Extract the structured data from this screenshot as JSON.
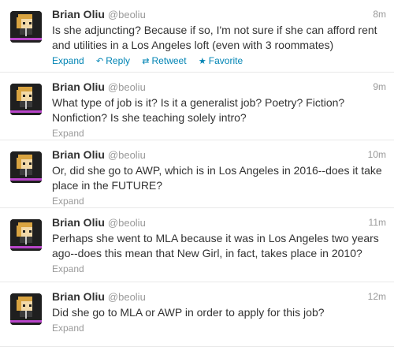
{
  "tweets": [
    {
      "fullname": "Brian Oliu",
      "username": "@beoliu",
      "time": "8m",
      "text": "Is she adjuncting? Because if so, I'm not sure if she can afford rent and utilities in a Los Angeles loft (even with 3 roommates)",
      "actions": {
        "expand": "Expand",
        "reply": "Reply",
        "retweet": "Retweet",
        "favorite": "Favorite"
      }
    },
    {
      "fullname": "Brian Oliu",
      "username": "@beoliu",
      "time": "9m",
      "text": "What type of job is it? Is it a generalist job? Poetry? Fiction? Nonfiction? Is she teaching solely intro?",
      "actions": {
        "expand": "Expand"
      }
    },
    {
      "fullname": "Brian Oliu",
      "username": "@beoliu",
      "time": "10m",
      "text": "Or, did she go to AWP, which is in Los Angeles in 2016--does it take place in the FUTURE?",
      "actions": {
        "expand": "Expand"
      }
    },
    {
      "fullname": "Brian Oliu",
      "username": "@beoliu",
      "time": "11m",
      "text": "Perhaps she went to MLA because it was in Los Angeles two years ago--does this mean that New Girl, in fact, takes place in 2010?",
      "actions": {
        "expand": "Expand"
      }
    },
    {
      "fullname": "Brian Oliu",
      "username": "@beoliu",
      "time": "12m",
      "text": "Did she go to MLA or AWP in order to apply for this job?",
      "actions": {
        "expand": "Expand"
      }
    }
  ],
  "icons": {
    "reply": "reply-arrow-icon",
    "retweet": "retweet-icon",
    "favorite": "star-icon"
  },
  "colors": {
    "link": "#0084b4",
    "muted": "#999999",
    "text": "#333333"
  }
}
